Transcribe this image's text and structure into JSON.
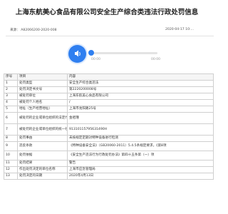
{
  "page_title": "上海东航美心食品有限公司安全生产综合类违法行政处罚信息",
  "meta": {
    "source_label": "来源：",
    "code": "A82066200-2020-008",
    "date_text": "2020-04-17 10:…"
  },
  "audio": {
    "start_time": "00:00",
    "end_time": "00:00",
    "progress": 0
  },
  "table": {
    "headers": [
      "序号",
      "项目",
      "内容"
    ],
    "rows": [
      [
        "1",
        "处罚类型",
        "安全生产综合类违法"
      ],
      [
        "2",
        "处罚决定书文号",
        "第2220200008号"
      ],
      [
        "3",
        "被处罚单位",
        "上海东航美心食品有限公司"
      ],
      [
        "4",
        "被处罚个人姓名",
        "/"
      ],
      [
        "5",
        "地址（生产经营地址）",
        "上海市龙阳路25号"
      ],
      [
        "6",
        "被处罚的企业或单位组织的法定代表人姓名",
        "金祖瑾"
      ],
      [
        "7",
        "被处罚的企业或单位组织的统一社会信用代码",
        "91310115795631490H"
      ],
      [
        "8",
        "处罚事由",
        "未按规定定期对特种设备进行检测"
      ],
      [
        "9",
        "违反条款",
        "《特种设备安全法》（GB20060-2011）5.4.5条规定要求，《第8项"
      ],
      [
        "10",
        "处罚依据",
        "《安全生产违法行为行政处罚办法》第四十五条第（一）项"
      ],
      [
        "11",
        "处罚结果",
        "警告"
      ],
      [
        "12",
        "作出处罚决定的单位名称",
        "上海市应急管理局"
      ],
      [
        "13",
        "处罚决定的日期",
        "2020年4月13日"
      ]
    ]
  },
  "colors": {
    "accent": "#2f7ff0",
    "border": "#cfcfcf"
  }
}
